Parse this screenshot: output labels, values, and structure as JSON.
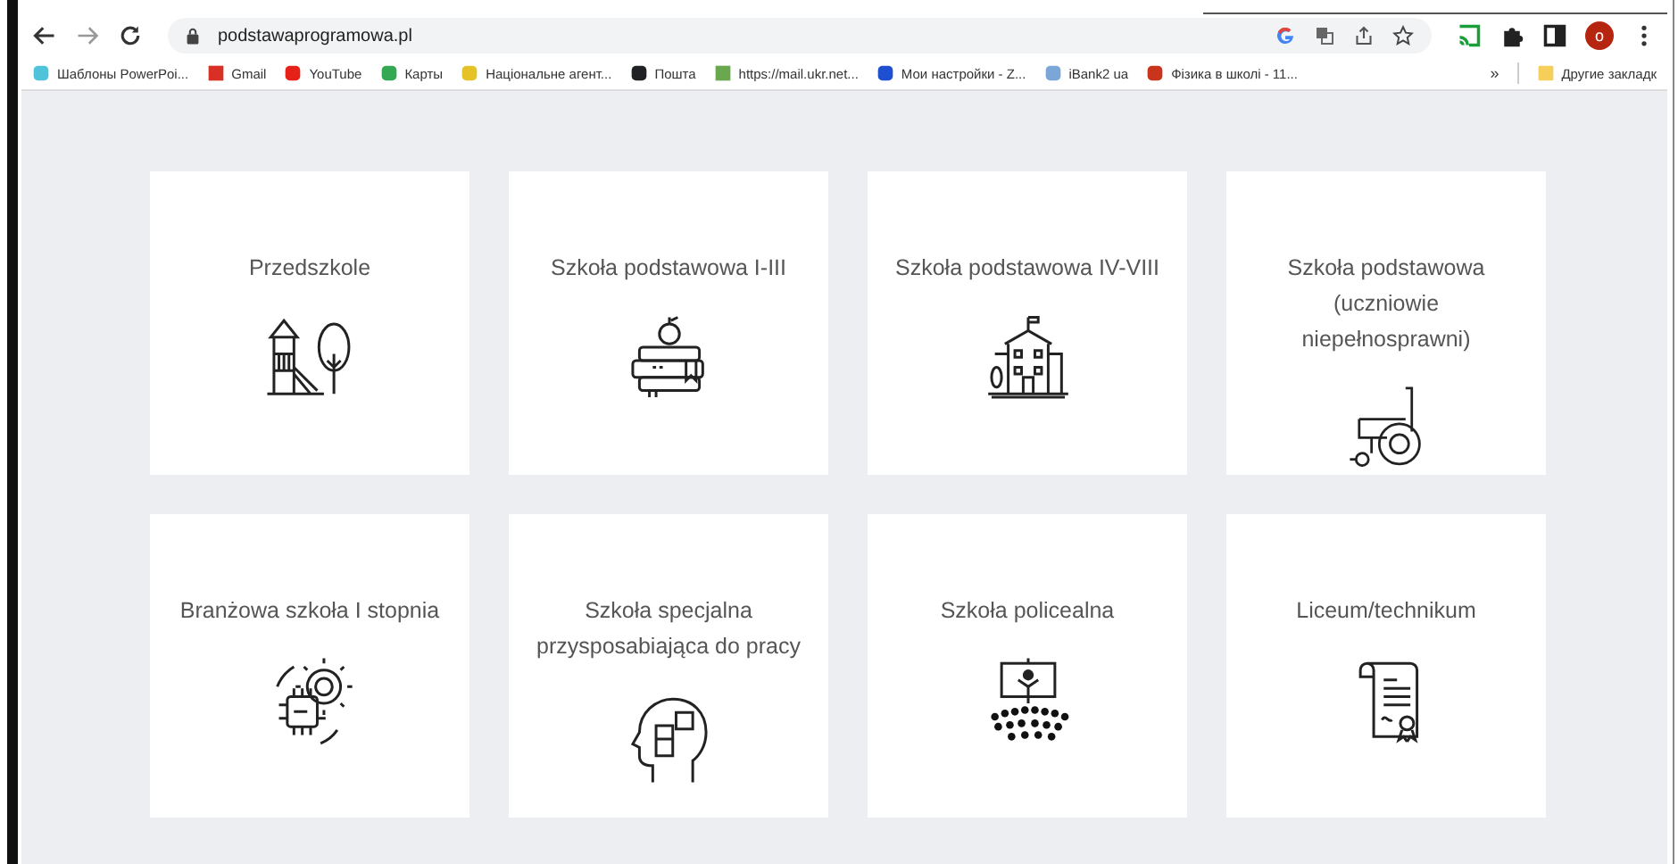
{
  "browser": {
    "url": "podstawaprogramowa.pl",
    "profile_initial": "o",
    "bookmarks": [
      {
        "label": "Шаблоны PowerPoi..."
      },
      {
        "label": "Gmail"
      },
      {
        "label": "YouTube"
      },
      {
        "label": "Карты"
      },
      {
        "label": "Національне агент..."
      },
      {
        "label": "Пошта"
      },
      {
        "label": "https://mail.ukr.net..."
      },
      {
        "label": "Мои настройки - Z..."
      },
      {
        "label": "iBank2 ua"
      },
      {
        "label": "Фізика в школі - 11..."
      }
    ],
    "more_bookmarks": "»",
    "other_bookmarks": "Другие закладк"
  },
  "cards": [
    {
      "title": "Przedszkole"
    },
    {
      "title": "Szkoła podstawowa I-III"
    },
    {
      "title": "Szkoła podstawowa IV-VIII"
    },
    {
      "title": "Szkoła podstawowa (uczniowie niepełnosprawni)"
    },
    {
      "title": "Branżowa szkoła I stopnia"
    },
    {
      "title": "Szkoła specjalna przysposabiająca do pracy"
    },
    {
      "title": "Szkoła policealna"
    },
    {
      "title": "Liceum/technikum"
    }
  ]
}
